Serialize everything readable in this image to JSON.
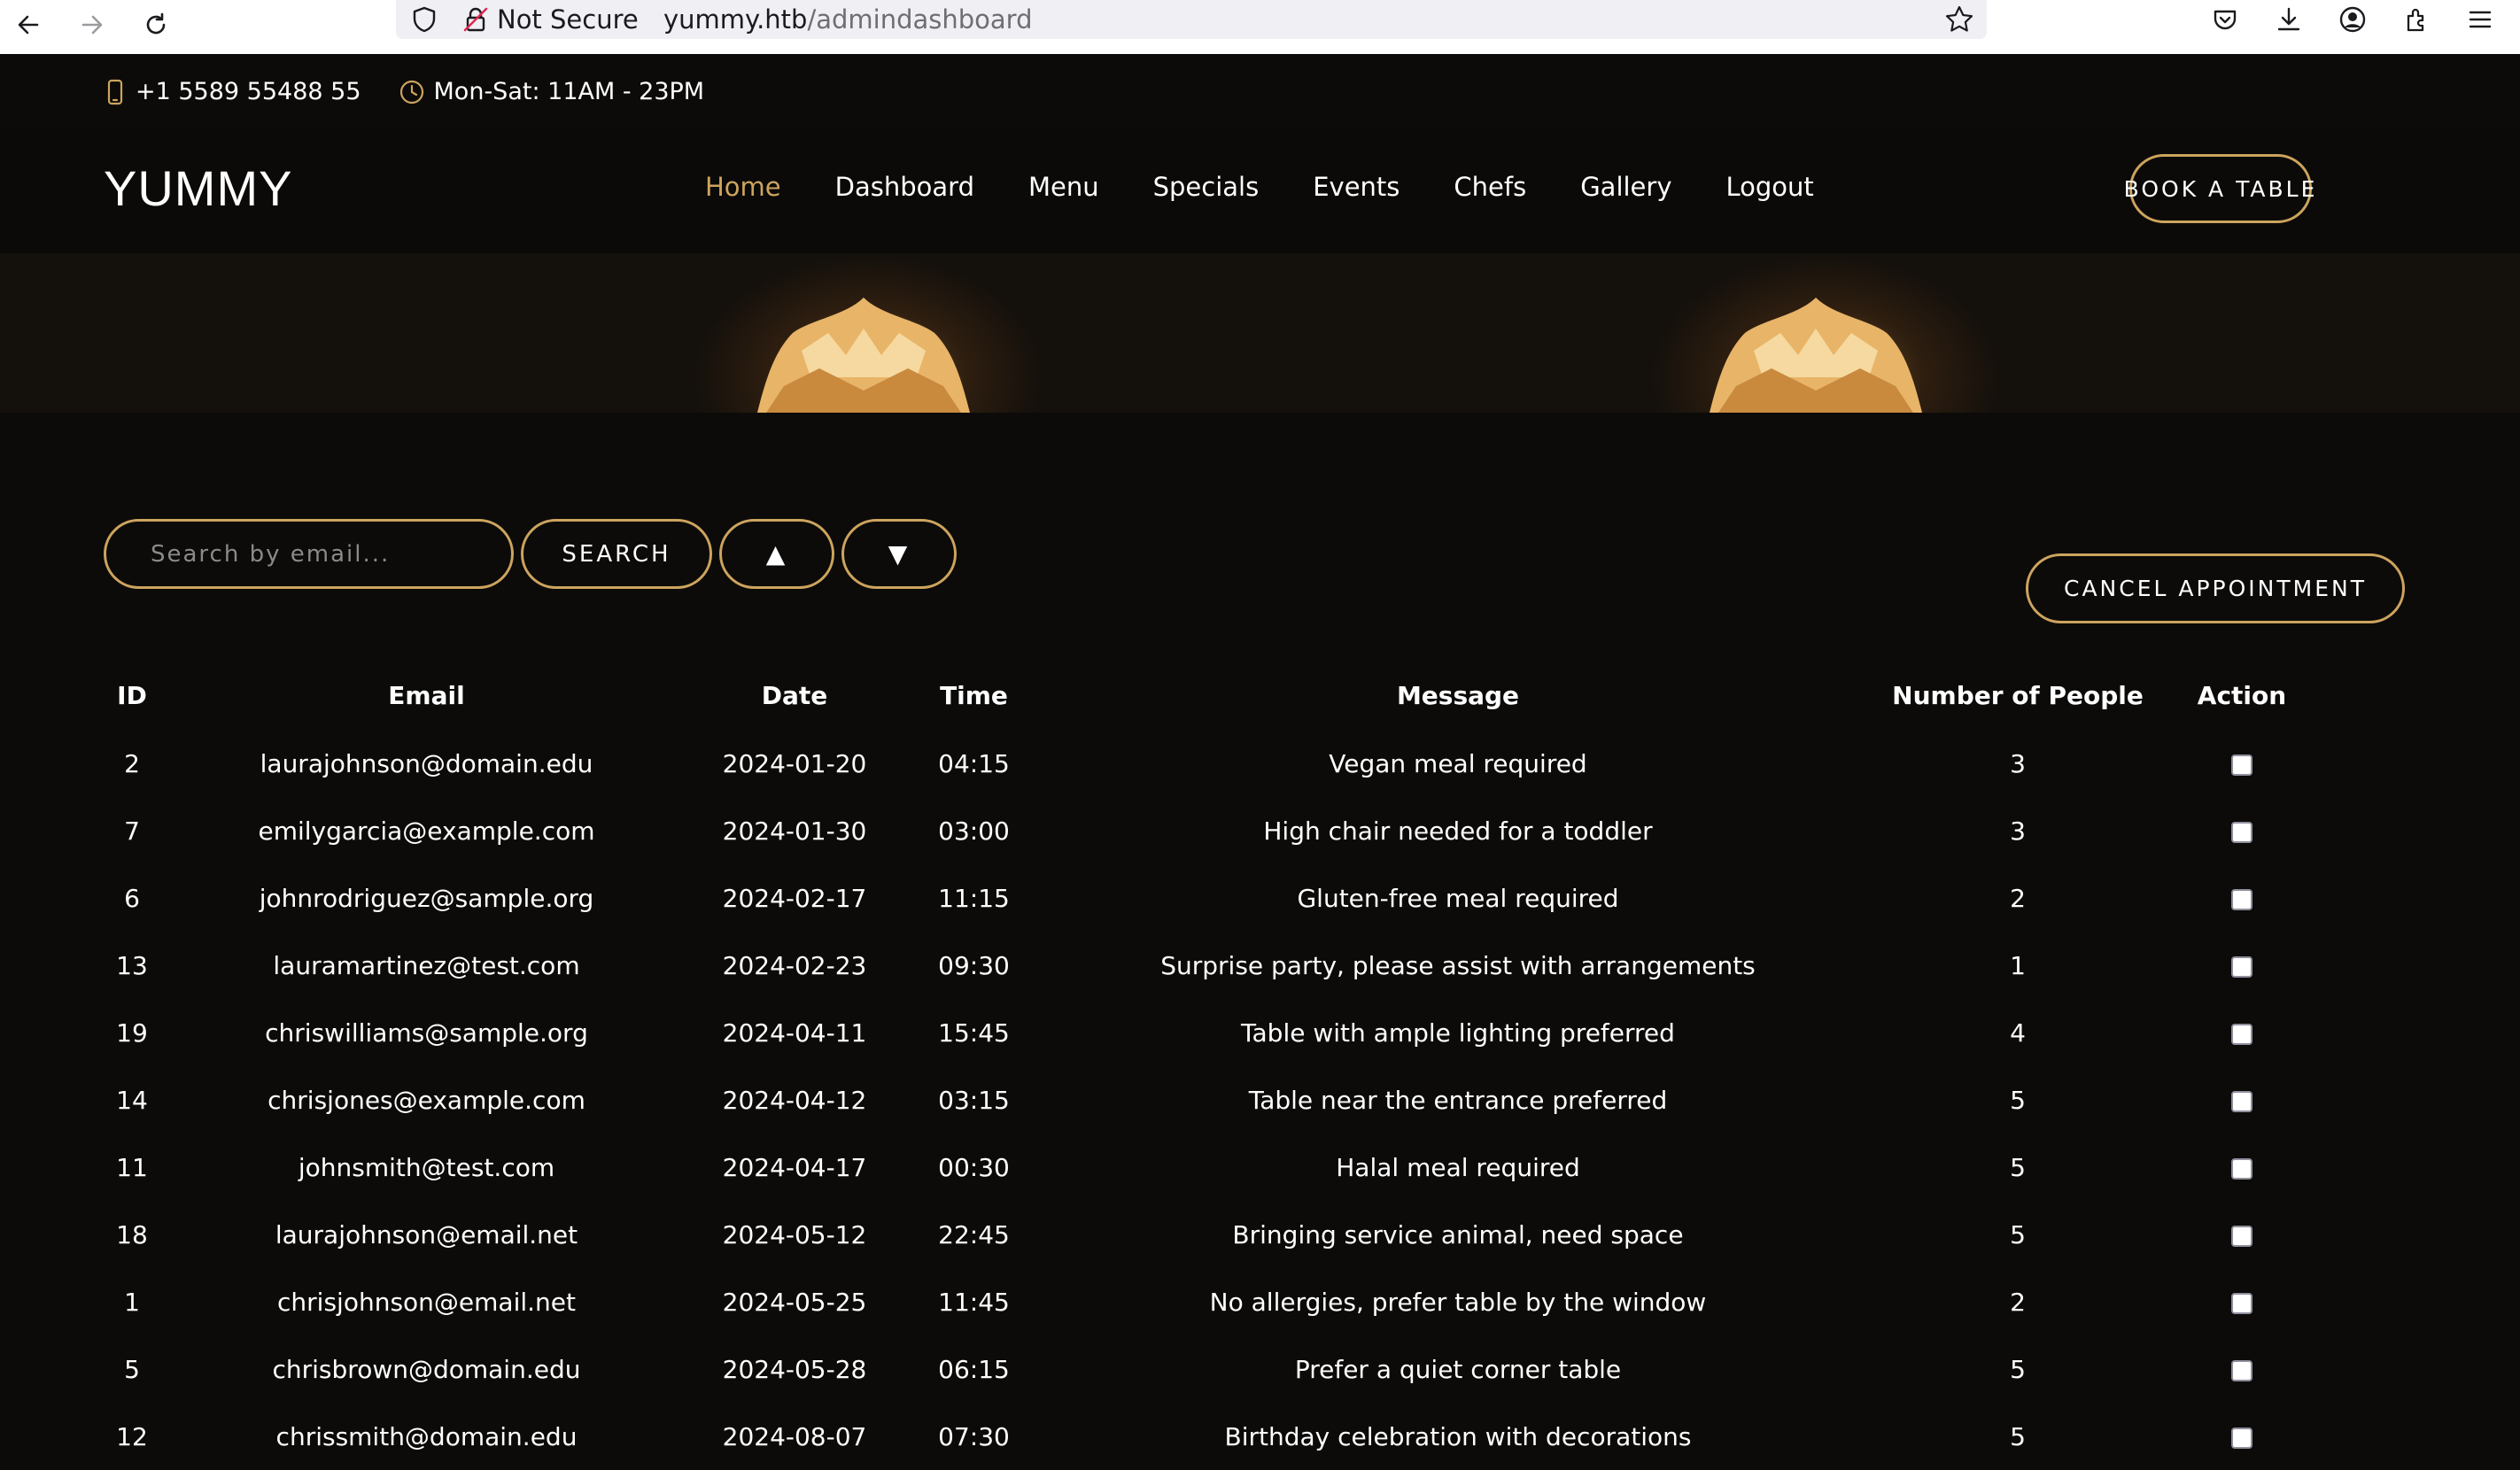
{
  "browser": {
    "security_label": "Not Secure",
    "url_host": "yummy.htb",
    "url_path": "/admindashboard"
  },
  "topbar": {
    "phone": "+1 5589 55488 55",
    "hours": "Mon-Sat: 11AM - 23PM"
  },
  "header": {
    "logo": "YUMMY",
    "nav": [
      "Home",
      "Dashboard",
      "Menu",
      "Specials",
      "Events",
      "Chefs",
      "Gallery",
      "Logout"
    ],
    "active_nav": "Home",
    "book_label": "BOOK A TABLE"
  },
  "controls": {
    "search_placeholder": "Search by email...",
    "search_label": "SEARCH",
    "sort_asc_label": "▲",
    "sort_desc_label": "▼",
    "cancel_label": "CANCEL APPOINTMENT"
  },
  "table": {
    "headers": [
      "ID",
      "Email",
      "Date",
      "Time",
      "Message",
      "Number of People",
      "Action"
    ],
    "rows": [
      [
        "2",
        "laurajohnson@domain.edu",
        "2024-01-20",
        "04:15",
        "Vegan meal required",
        "3"
      ],
      [
        "7",
        "emilygarcia@example.com",
        "2024-01-30",
        "03:00",
        "High chair needed for a toddler",
        "3"
      ],
      [
        "6",
        "johnrodriguez@sample.org",
        "2024-02-17",
        "11:15",
        "Gluten-free meal required",
        "2"
      ],
      [
        "13",
        "lauramartinez@test.com",
        "2024-02-23",
        "09:30",
        "Surprise party, please assist with arrangements",
        "1"
      ],
      [
        "19",
        "chriswilliams@sample.org",
        "2024-04-11",
        "15:45",
        "Table with ample lighting preferred",
        "4"
      ],
      [
        "14",
        "chrisjones@example.com",
        "2024-04-12",
        "03:15",
        "Table near the entrance preferred",
        "5"
      ],
      [
        "11",
        "johnsmith@test.com",
        "2024-04-17",
        "00:30",
        "Halal meal required",
        "5"
      ],
      [
        "18",
        "laurajohnson@email.net",
        "2024-05-12",
        "22:45",
        "Bringing service animal, need space",
        "5"
      ],
      [
        "1",
        "chrisjohnson@email.net",
        "2024-05-25",
        "11:45",
        "No allergies, prefer table by the window",
        "2"
      ],
      [
        "5",
        "chrisbrown@domain.edu",
        "2024-05-28",
        "06:15",
        "Prefer a quiet corner table",
        "5"
      ],
      [
        "12",
        "chrissmith@domain.edu",
        "2024-08-07",
        "07:30",
        "Birthday celebration with decorations",
        "5"
      ]
    ]
  },
  "colors": {
    "accent": "#cda45e",
    "background": "#0c0b09"
  }
}
